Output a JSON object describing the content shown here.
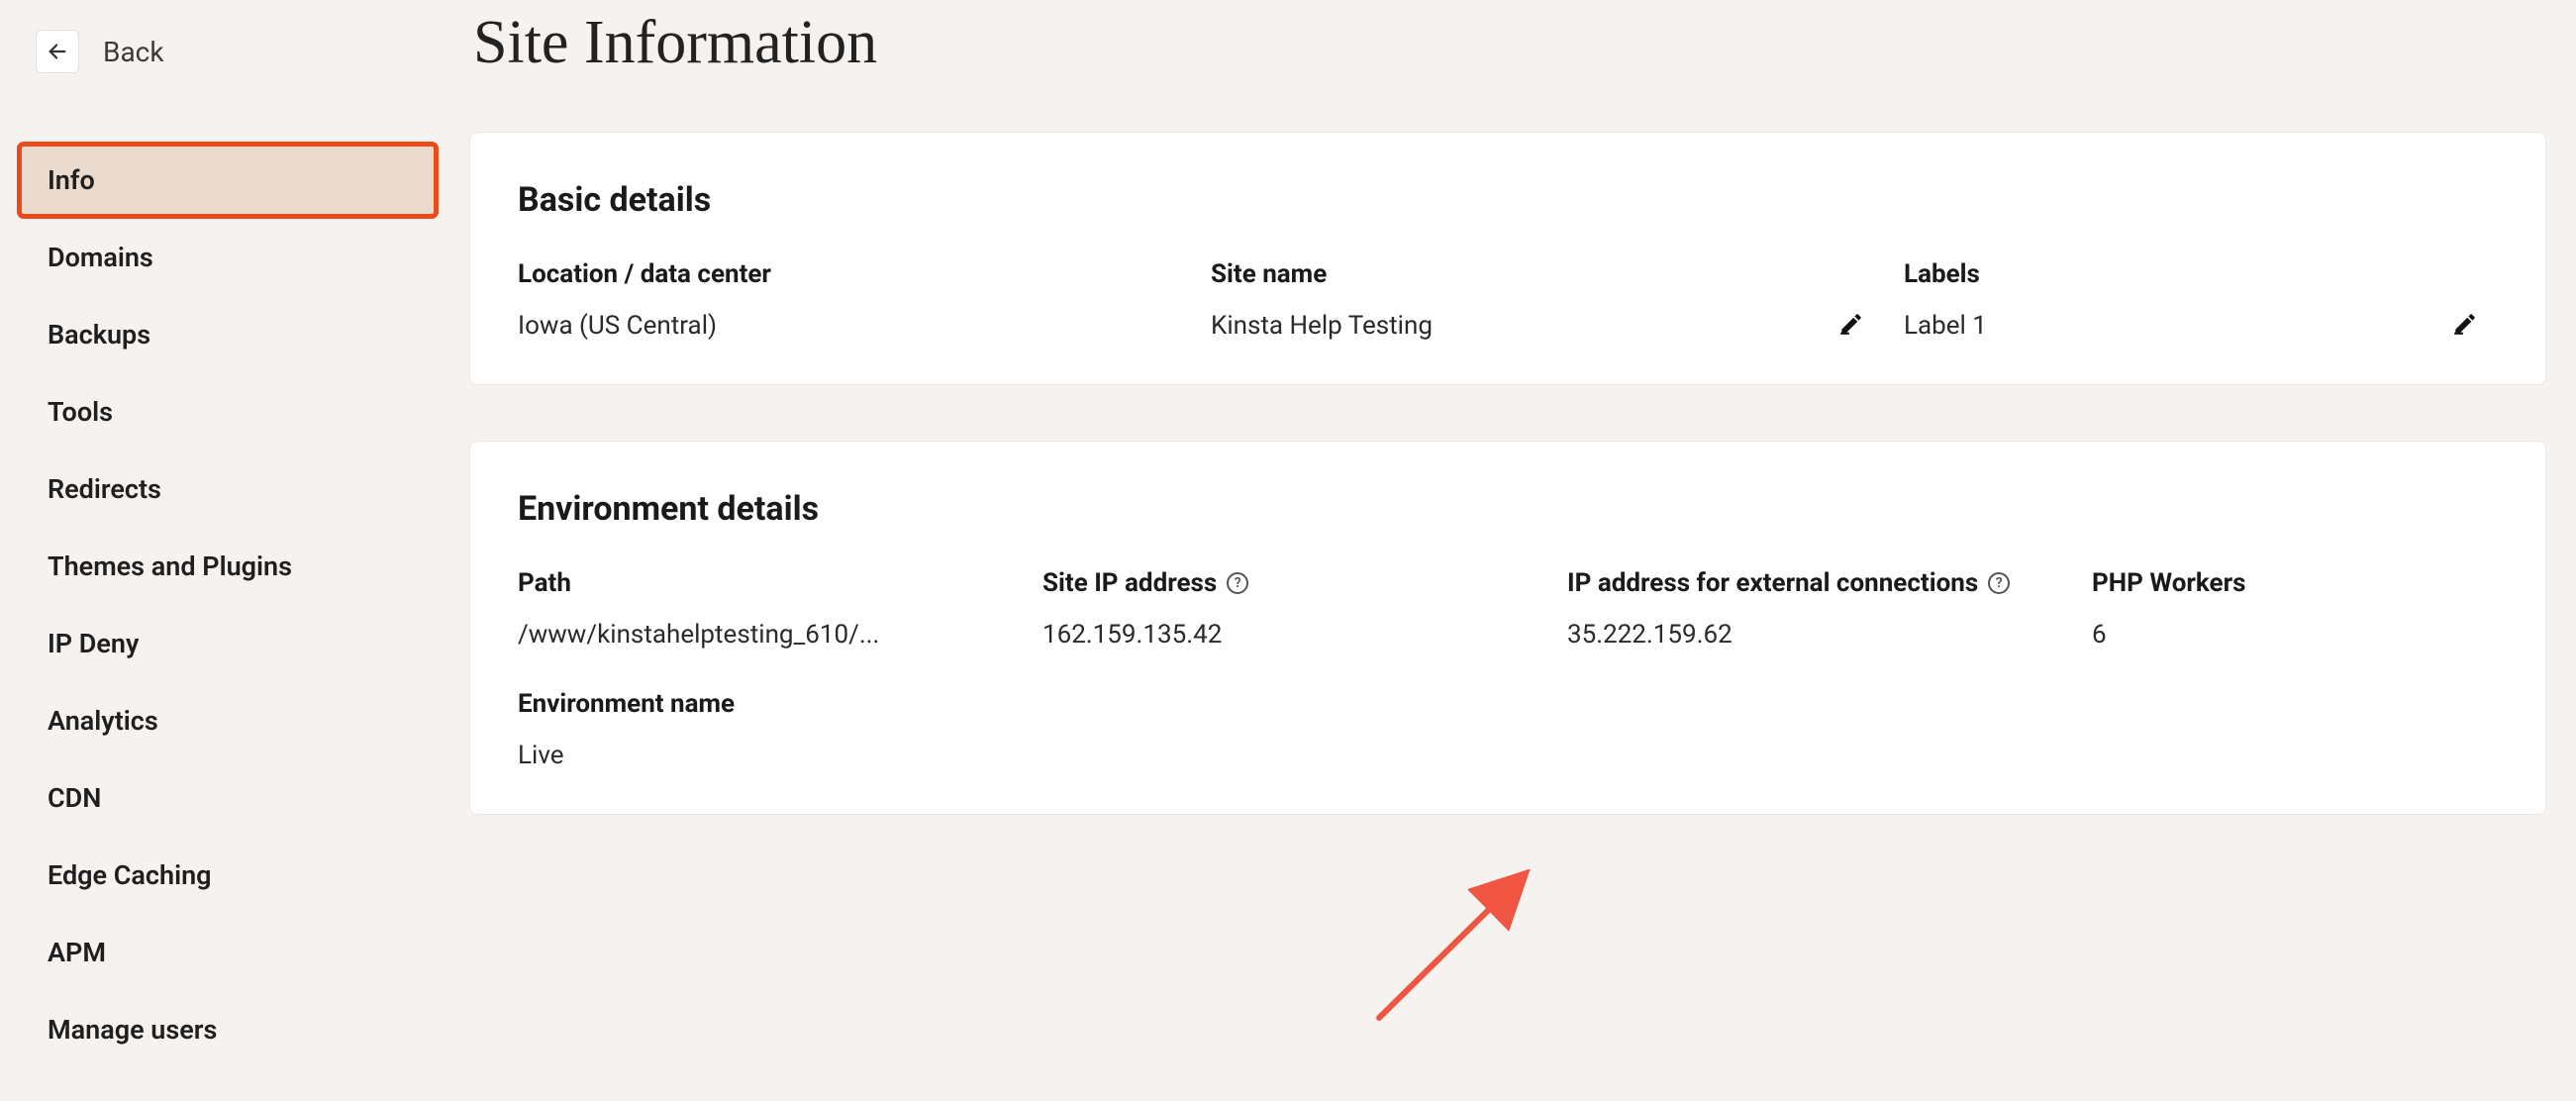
{
  "back_label": "Back",
  "page_title": "Site Information",
  "sidebar": {
    "items": [
      {
        "label": "Info",
        "active": true
      },
      {
        "label": "Domains"
      },
      {
        "label": "Backups"
      },
      {
        "label": "Tools"
      },
      {
        "label": "Redirects"
      },
      {
        "label": "Themes and Plugins"
      },
      {
        "label": "IP Deny"
      },
      {
        "label": "Analytics"
      },
      {
        "label": "CDN"
      },
      {
        "label": "Edge Caching"
      },
      {
        "label": "APM"
      },
      {
        "label": "Manage users"
      }
    ]
  },
  "basic": {
    "heading": "Basic details",
    "location_label": "Location / data center",
    "location_value": "Iowa (US Central)",
    "site_name_label": "Site name",
    "site_name_value": "Kinsta Help Testing",
    "labels_label": "Labels",
    "labels_value": "Label 1"
  },
  "env": {
    "heading": "Environment details",
    "path_label": "Path",
    "path_value": "/www/kinstahelptesting_610/...",
    "site_ip_label": "Site IP address",
    "site_ip_value": "162.159.135.42",
    "ext_ip_label": "IP address for external connections",
    "ext_ip_value": "35.222.159.62",
    "php_workers_label": "PHP Workers",
    "php_workers_value": "6",
    "env_name_label": "Environment name",
    "env_name_value": "Live"
  },
  "annotation": {
    "arrow_color": "#f05541",
    "highlight_color": "#ea4b1a"
  }
}
